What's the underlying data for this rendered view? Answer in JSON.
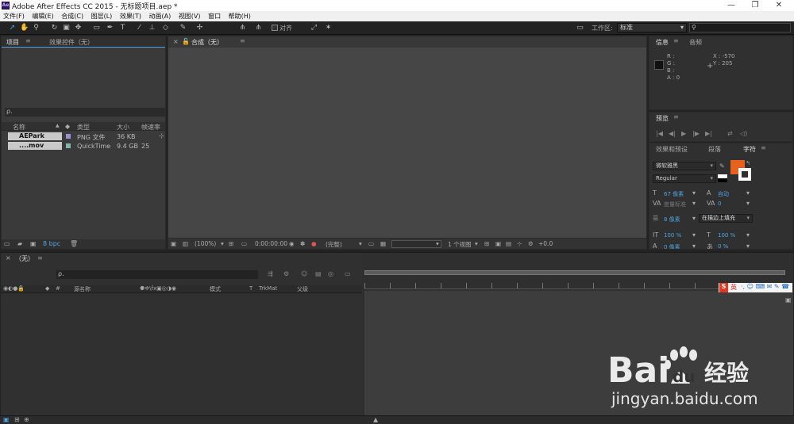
{
  "window": {
    "title": "Adobe After Effects CC 2015 - 无标题项目.aep *",
    "app_logo": "Ae",
    "controls": [
      "—",
      "❐",
      "✕"
    ]
  },
  "menu": [
    "文件(F)",
    "编辑(E)",
    "合成(C)",
    "图层(L)",
    "效果(T)",
    "动画(A)",
    "视图(V)",
    "窗口",
    "帮助(H)"
  ],
  "toolbar": {
    "snap_label": "对齐",
    "workspace_label": "工作区:",
    "workspace_value": "标准",
    "search_icon": "search-icon"
  },
  "project_panel": {
    "tab_project": "项目",
    "tab_effects": "效果控件（无）",
    "menu_glyph": "≡",
    "search_glyph": "ρ.",
    "columns": {
      "name": "名称",
      "type": "类型",
      "size": "大小",
      "rate": "帧速率"
    },
    "rows": [
      {
        "name": "AEPark ....png",
        "type": "PNG 文件",
        "size": "36 KB",
        "rate": "",
        "color": "#9a8fd0"
      },
      {
        "name": "....mov",
        "type": "QuickTime",
        "size": "9.4 GB",
        "rate": "25",
        "color": "#7fb7a9"
      }
    ],
    "bpc": "8 bpc"
  },
  "comp_panel": {
    "close_glyph": "×",
    "tab_label": "合成（无）",
    "menu_glyph": "≡",
    "footer": {
      "zoom": "(100%)",
      "timecode": "0:00:00:00",
      "resolution": "(完整)",
      "views": "1 个视图",
      "exposure": "+0.0"
    }
  },
  "info_panel": {
    "tab_info": "信息",
    "tab_audio": "音频",
    "menu_glyph": "≡",
    "r": "R :",
    "g": "G :",
    "b": "B :",
    "a": "A : 0",
    "x": "X : -570",
    "y": "Y : 205"
  },
  "preview_panel": {
    "tab_label": "预览",
    "menu_glyph": "≡",
    "controls": [
      "|◀",
      "◀|",
      "▶",
      "|▶",
      "▶|",
      "⇄",
      "◁)"
    ]
  },
  "character_panel": {
    "tab_effects": "效果和预设",
    "tab_paragraph": "段落",
    "tab_character": "字符",
    "menu_glyph": "≡",
    "font_family": "微软雅黑",
    "font_style": "Regular",
    "font_size": "67 像素",
    "leading": "自动",
    "kerning": "度量标准",
    "tracking": "0",
    "stroke_width": "8 像素",
    "stroke_mode": "在描边上填充",
    "vert_scale": "100 %",
    "horiz_scale": "100 %",
    "baseline": "0 像素",
    "tsume": "0 %",
    "fill_color": "#e8621f",
    "stroke_color": "#ffffff"
  },
  "timeline": {
    "close_glyph": "×",
    "tab_label": "（无）",
    "menu_glyph": "≡",
    "search_glyph": "ρ.",
    "columns": {
      "hash": "#",
      "source_name": "源名称",
      "mode": "模式",
      "t": "T",
      "trkmat": "TrkMat",
      "parent": "父级"
    }
  },
  "ime_bar": {
    "logo": "S",
    "lang": "英",
    "icons": "·, ☺ ⌨ ✉ ✎ ☎"
  },
  "watermark": {
    "brand": "Bai du 经验",
    "url": "jingyan.baidu.com"
  }
}
